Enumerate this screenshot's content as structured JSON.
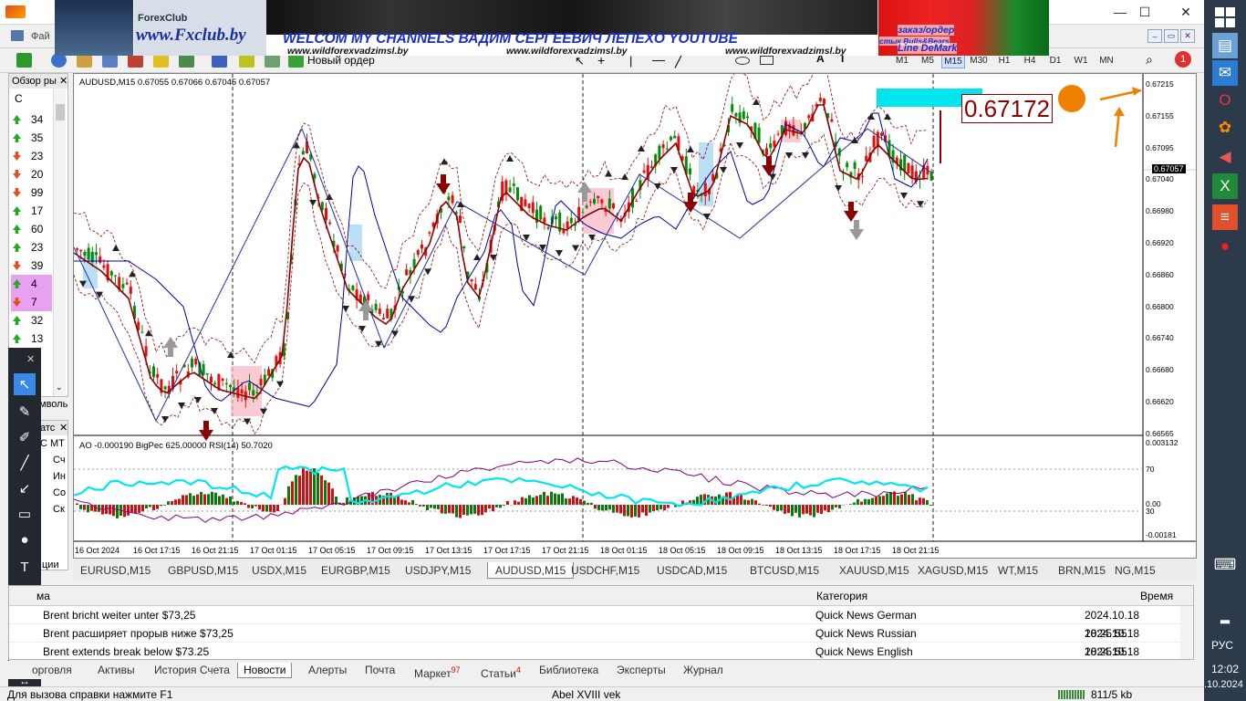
{
  "window": {
    "minimize": "—",
    "maximize": "☐",
    "close": "✕"
  },
  "menu": {
    "file_label": "Фай"
  },
  "toolbar": {
    "new_order_label": "Новый ордер",
    "timeframes": [
      "M1",
      "M5",
      "M15",
      "M30",
      "H1",
      "H4",
      "D1",
      "W1",
      "MN"
    ],
    "active_timeframe": "M15",
    "alert_badge": "1"
  },
  "banner": {
    "fxclub_name": "ForexClub",
    "fxclub_url": "www.Fxclub.by",
    "headline": "WELCOM MY CHANNELS ВАДИМ СЕРГЕЕВИЧ ЛЕПЕХО YOUTUBE",
    "url_1": "www.wildforexvadzimsl.by",
    "url_2": "www.wildforexvadzimsl.by",
    "url_3": "www.wildforexvadzimsl.by",
    "order_text": "заказ/ордер",
    "stock_text": "стык Bulls&Bears",
    "demark_text": "Line DeMark"
  },
  "market_watch": {
    "header": "Обзор ры",
    "sort_label": "С",
    "rows": [
      {
        "value": "34",
        "dir": "up"
      },
      {
        "value": "35",
        "dir": "up"
      },
      {
        "value": "23",
        "dir": "down"
      },
      {
        "value": "20",
        "dir": "down"
      },
      {
        "value": "99",
        "dir": "down"
      },
      {
        "value": "17",
        "dir": "up"
      },
      {
        "value": "60",
        "dir": "up"
      },
      {
        "value": "23",
        "dir": "up"
      },
      {
        "value": "39",
        "dir": "down"
      },
      {
        "value": "4",
        "dir": "up"
      },
      {
        "value": "7",
        "dir": "down"
      },
      {
        "value": "32",
        "dir": "up"
      },
      {
        "value": "13",
        "dir": "up"
      }
    ],
    "symbols_tab": "мволь"
  },
  "navigator": {
    "header": "атс",
    "items": [
      "С МТ",
      "Сч",
      "Ин",
      "Со",
      "Ск"
    ],
    "footer": "ции"
  },
  "chart": {
    "info": "AUDUSD,M15  0.67055 0.67066 0.67045 0.67057",
    "current_price": "0.67057",
    "big_price": "0.67172",
    "sub_info": "AO -0.000190  BigPec 625.00000  RSI(14) 50.7020",
    "price_ticks": [
      "0.67215",
      "0.67155",
      "0.67095",
      "0.67040",
      "0.66980",
      "0.66920",
      "0.66860",
      "0.66800",
      "0.66740",
      "0.66680",
      "0.66620",
      "0.66565"
    ],
    "sub_ticks": [
      "0.003132",
      "70",
      "0.00",
      "30",
      "-0.00181"
    ],
    "time_ticks": [
      "16 Oct 2024",
      "16 Oct 17:15",
      "16 Oct 21:15",
      "17 Oct 01:15",
      "17 Oct 05:15",
      "17 Oct 09:15",
      "17 Oct 13:15",
      "17 Oct 17:15",
      "17 Oct 21:15",
      "18 Oct 01:15",
      "18 Oct 05:15",
      "18 Oct 09:15",
      "18 Oct 13:15",
      "18 Oct 17:15",
      "18 Oct 21:15"
    ],
    "colors": {
      "bull": "#0a8a0a",
      "bear": "#e01010",
      "ma": "#8b0000",
      "ma2": "#0000a0",
      "upper": "#8b0000",
      "rsi": "#00e5ee",
      "cci": "#800080",
      "arrow": "#f08000"
    }
  },
  "chart_tabs": [
    "EURUSD,M15",
    "GBPUSD,M15",
    "USDX,M15",
    "EURGBP,M15",
    "USDJPY,M15",
    "AUDUSD,M15",
    "USDCHF,M15",
    "USDCAD,M15",
    "BTCUSD,M15",
    "XAUUSD,M15",
    "XAGUSD,M15",
    "WT,M15",
    "BRN,M15",
    "NG,M15"
  ],
  "active_chart_tab": "AUDUSD,M15",
  "terminal": {
    "headers": {
      "subject": "ма",
      "category": "Категория",
      "time": "Время"
    },
    "rows": [
      {
        "subject": "Brent bricht weiter unter $73,25",
        "category": "Quick News German",
        "time": "2024.10.18 18:25:55"
      },
      {
        "subject": "Brent расширяет прорыв ниже $73,25",
        "category": "Quick News Russian",
        "time": "2024.10.18 18:25:55"
      },
      {
        "subject": "Brent extends break below $73.25",
        "category": "Quick News English",
        "time": "2024.10.18 18:25:55"
      }
    ]
  },
  "terminal_tabs": [
    {
      "label": "орговля"
    },
    {
      "label": "Активы"
    },
    {
      "label": "История Счета"
    },
    {
      "label": "Новости"
    },
    {
      "label": "Алерты"
    },
    {
      "label": "Почта"
    },
    {
      "label": "Маркет",
      "badge": "97"
    },
    {
      "label": "Статьи",
      "badge": "4"
    },
    {
      "label": "Библиотека"
    },
    {
      "label": "Эксперты"
    },
    {
      "label": "Журнал"
    }
  ],
  "active_terminal_tab": "Новости",
  "status": {
    "help": "Для вызова справки нажмите F1",
    "profile": "Abel XVIII vek",
    "traffic": "811/5 kb"
  },
  "taskbar": {
    "lang": "РУС",
    "time": "12:02",
    "date": ".10.2024"
  }
}
